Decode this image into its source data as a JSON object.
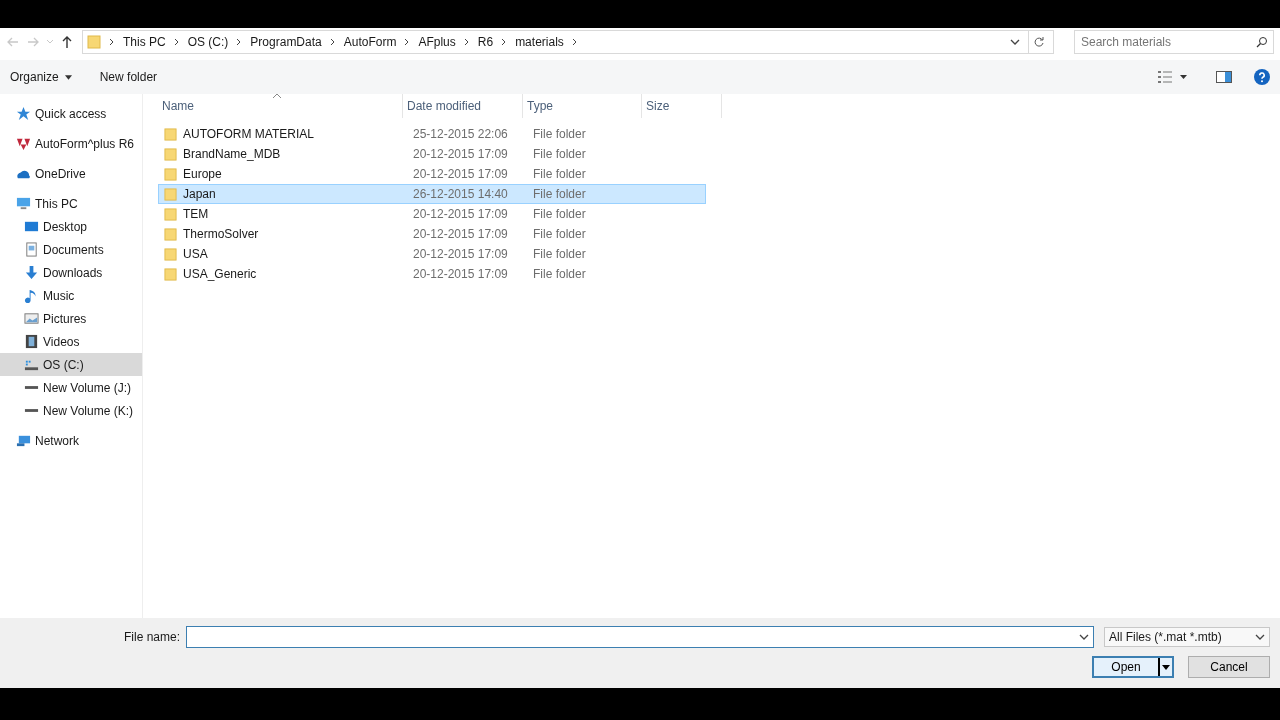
{
  "address_bar": {
    "crumbs": [
      "This PC",
      "OS (C:)",
      "ProgramData",
      "AutoForm",
      "AFplus",
      "R6",
      "materials"
    ]
  },
  "search": {
    "placeholder": "Search materials"
  },
  "toolbar": {
    "organize": "Organize",
    "new_folder": "New folder"
  },
  "sidebar": {
    "items": [
      {
        "label": "Quick access",
        "kind": "star",
        "selected": false
      },
      {
        "label": "AutoForm^plus R6",
        "kind": "logo",
        "selected": false
      },
      {
        "label": "OneDrive",
        "kind": "cloud",
        "selected": false
      },
      {
        "label": "This PC",
        "kind": "pc",
        "selected": false,
        "children": [
          {
            "label": "Desktop",
            "kind": "desktop",
            "selected": false
          },
          {
            "label": "Documents",
            "kind": "doc",
            "selected": false
          },
          {
            "label": "Downloads",
            "kind": "download",
            "selected": false
          },
          {
            "label": "Music",
            "kind": "music",
            "selected": false
          },
          {
            "label": "Pictures",
            "kind": "pictures",
            "selected": false
          },
          {
            "label": "Videos",
            "kind": "video",
            "selected": false
          },
          {
            "label": "OS (C:)",
            "kind": "osdrive",
            "selected": true
          },
          {
            "label": "New Volume (J:)",
            "kind": "drive",
            "selected": false
          },
          {
            "label": "New Volume (K:)",
            "kind": "drive",
            "selected": false
          }
        ]
      },
      {
        "label": "Network",
        "kind": "network",
        "selected": false
      }
    ]
  },
  "table": {
    "columns": [
      "Name",
      "Date modified",
      "Type",
      "Size"
    ],
    "rows": [
      {
        "name": "AUTOFORM MATERIAL",
        "date": "25-12-2015 22:06",
        "type": "File folder",
        "selected": false
      },
      {
        "name": "BrandName_MDB",
        "date": "20-12-2015 17:09",
        "type": "File folder",
        "selected": false
      },
      {
        "name": "Europe",
        "date": "20-12-2015 17:09",
        "type": "File folder",
        "selected": false
      },
      {
        "name": "Japan",
        "date": "26-12-2015 14:40",
        "type": "File folder",
        "selected": true
      },
      {
        "name": "TEM",
        "date": "20-12-2015 17:09",
        "type": "File folder",
        "selected": false
      },
      {
        "name": "ThermoSolver",
        "date": "20-12-2015 17:09",
        "type": "File folder",
        "selected": false
      },
      {
        "name": "USA",
        "date": "20-12-2015 17:09",
        "type": "File folder",
        "selected": false
      },
      {
        "name": "USA_Generic",
        "date": "20-12-2015 17:09",
        "type": "File folder",
        "selected": false
      }
    ]
  },
  "footer": {
    "file_name_label": "File name:",
    "file_type": "All Files (*.mat *.mtb)",
    "open": "Open",
    "cancel": "Cancel"
  }
}
